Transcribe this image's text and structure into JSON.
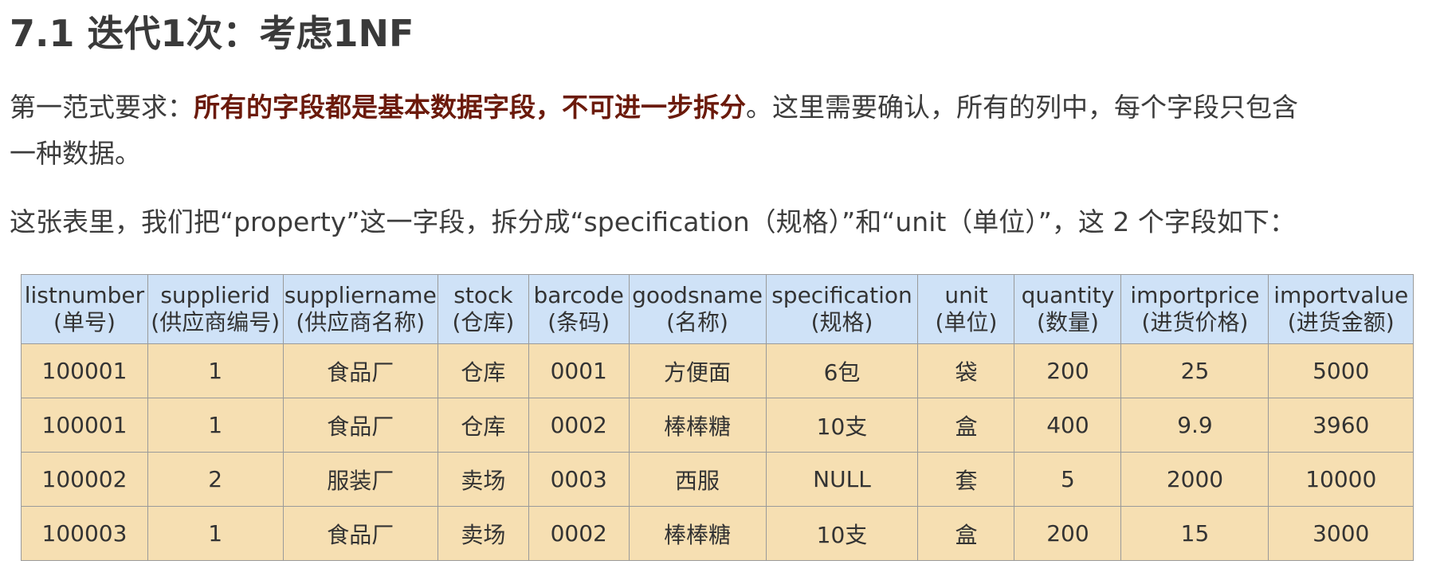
{
  "heading": "7.1 迭代1次：考虑1NF",
  "paragraph1": {
    "prefix": "第一范式要求：",
    "emphasis": "所有的字段都是基本数据字段，不可进一步拆分",
    "suffix": "。这里需要确认，所有的列中，每个字段只包含",
    "line2": "一种数据。"
  },
  "paragraph2": "这张表里，我们把“property”这一字段，拆分成“specification（规格）”和“unit（单位）”，这 2 个字段如下：",
  "table": {
    "columns": [
      {
        "en": "listnumber",
        "zh": "(单号)"
      },
      {
        "en": "supplierid",
        "zh": "(供应商编号)"
      },
      {
        "en": "suppliername",
        "zh": "(供应商名称)"
      },
      {
        "en": "stock",
        "zh": "(仓库)"
      },
      {
        "en": "barcode",
        "zh": "(条码)"
      },
      {
        "en": "goodsname",
        "zh": "(名称)"
      },
      {
        "en": "specification",
        "zh": "(规格)"
      },
      {
        "en": "unit",
        "zh": "(单位)"
      },
      {
        "en": "quantity",
        "zh": "(数量)"
      },
      {
        "en": "importprice",
        "zh": "(进货价格)"
      },
      {
        "en": "importvalue",
        "zh": "(进货金额)"
      }
    ],
    "rows": [
      [
        "100001",
        "1",
        "食品厂",
        "仓库",
        "0001",
        "方便面",
        "6包",
        "袋",
        "200",
        "25",
        "5000"
      ],
      [
        "100001",
        "1",
        "食品厂",
        "仓库",
        "0002",
        "棒棒糖",
        "10支",
        "盒",
        "400",
        "9.9",
        "3960"
      ],
      [
        "100002",
        "2",
        "服装厂",
        "卖场",
        "0003",
        "西服",
        "NULL",
        "套",
        "5",
        "2000",
        "10000"
      ],
      [
        "100003",
        "1",
        "食品厂",
        "卖场",
        "0002",
        "棒棒糖",
        "10支",
        "盒",
        "200",
        "15",
        "3000"
      ]
    ]
  },
  "colors": {
    "header_bg": "#cfe2f7",
    "row_bg": "#f6dfb2",
    "emphasis": "#6b1a0b",
    "border": "#9a9a9a"
  }
}
